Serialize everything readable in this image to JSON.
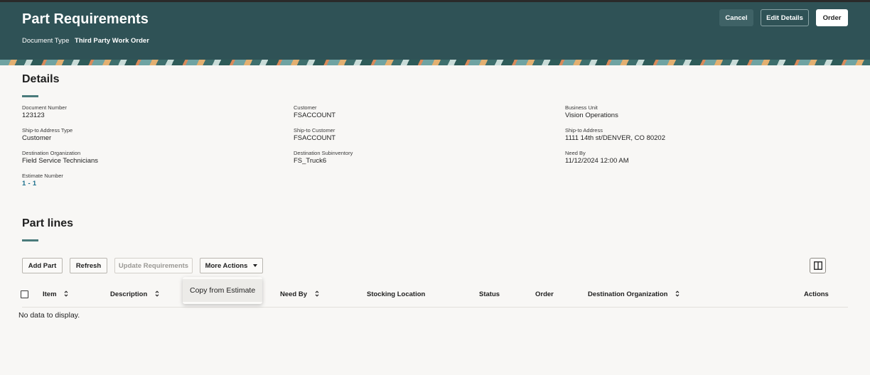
{
  "header": {
    "title": "Part Requirements",
    "document_type_label": "Document Type",
    "document_type_value": "Third Party Work Order",
    "buttons": {
      "cancel": "Cancel",
      "edit_details": "Edit Details",
      "order": "Order"
    }
  },
  "details": {
    "title": "Details",
    "fields": {
      "document_number": {
        "label": "Document Number",
        "value": "123123"
      },
      "customer": {
        "label": "Customer",
        "value": "FSACCOUNT"
      },
      "business_unit": {
        "label": "Business Unit",
        "value": "Vision Operations"
      },
      "ship_to_address_type": {
        "label": "Ship-to Address Type",
        "value": "Customer"
      },
      "ship_to_customer": {
        "label": "Ship-to Customer",
        "value": "FSACCOUNT"
      },
      "ship_to_address": {
        "label": "Ship-to Address",
        "value": "1111 14th st/DENVER, CO 80202"
      },
      "destination_organization": {
        "label": "Destination Organization",
        "value": "Field Service Technicians"
      },
      "destination_subinventory": {
        "label": "Destination Subinventory",
        "value": "FS_Truck6"
      },
      "need_by": {
        "label": "Need By",
        "value": "11/12/2024 12:00 AM"
      },
      "estimate_number": {
        "label": "Estimate Number",
        "value": "1 - 1"
      }
    }
  },
  "part_lines": {
    "title": "Part lines",
    "toolbar": {
      "add_part": "Add Part",
      "refresh": "Refresh",
      "update_requirements": "Update Requirements",
      "more_actions": "More Actions"
    },
    "more_actions_menu": [
      "Copy from Estimate"
    ],
    "columns": {
      "item": "Item",
      "description": "Description",
      "need_by": "Need By",
      "stocking_location": "Stocking Location",
      "status": "Status",
      "order": "Order",
      "destination_organization": "Destination Organization",
      "actions": "Actions"
    },
    "empty_message": "No data to display."
  },
  "colors": {
    "header_bg": "#2f5256",
    "accent_underline": "#4a7b7b",
    "link": "#1d6f8c",
    "page_bg": "#f8f7f5"
  }
}
